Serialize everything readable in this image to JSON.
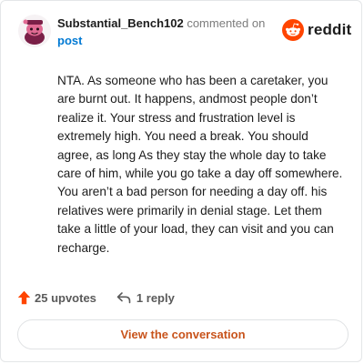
{
  "comment": {
    "username": "Substantial_Bench102",
    "action_text": " commented on ",
    "target_text": "post",
    "body": "NTA. As someone who has been a caretaker, you are burnt out. It happens, andmost people don’t realize it. Your stress and frustration level is extremely high. You need a break. You should agree, as long As they stay the whole day to take care of him, while you go take a day off somewhere. You aren’t a bad person for needing a day off. his relatives were primarily in denial stage. Let them take a little of your load, they can visit and you can recharge."
  },
  "brand": {
    "name": "reddit",
    "logo_icon": "reddit-snoo-icon",
    "accent_color": "#ff4500"
  },
  "actions": {
    "upvotes_label": "25 upvotes",
    "upvote_icon": "upvote-arrow-icon",
    "upvote_color": "#ff4500",
    "reply_label": "1 reply",
    "reply_icon": "reply-arrow-icon"
  },
  "footer": {
    "button_label": "View the conversation",
    "button_color": "#c8531b"
  }
}
